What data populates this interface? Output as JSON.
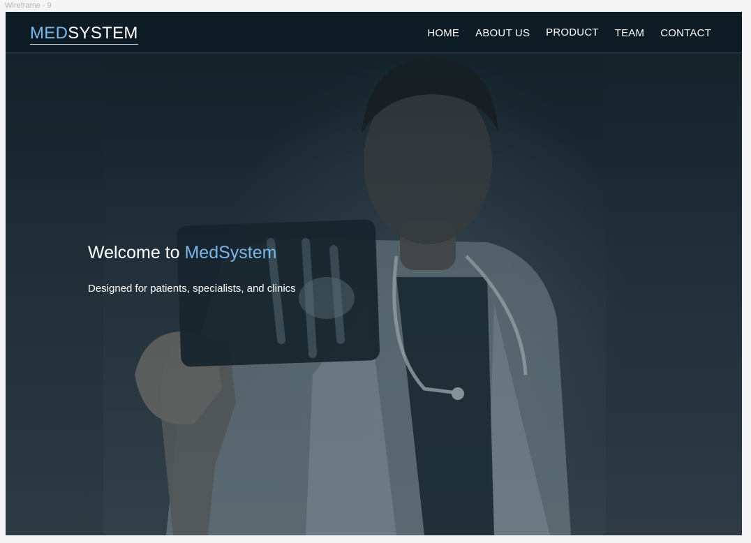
{
  "canvas": {
    "frame_label": "Wireframe - 9"
  },
  "navbar": {
    "logo": {
      "accent_text": "MED",
      "rest_text": "SYSTEM"
    },
    "links": [
      {
        "label": "HOME"
      },
      {
        "label": "ABOUT US"
      },
      {
        "label": "PRODUCT"
      },
      {
        "label": "TEAM"
      },
      {
        "label": "CONTACT"
      }
    ]
  },
  "hero": {
    "title_prefix": "Welcome to ",
    "title_accent": "MedSystem",
    "subtitle": "Designed for patients, specialists, and clinics",
    "image_description_icon": "doctor-with-xray-photo"
  },
  "colors": {
    "accent": "#7ab6ea",
    "navbar_bg": "#0d1c24",
    "text": "#ffffff"
  }
}
